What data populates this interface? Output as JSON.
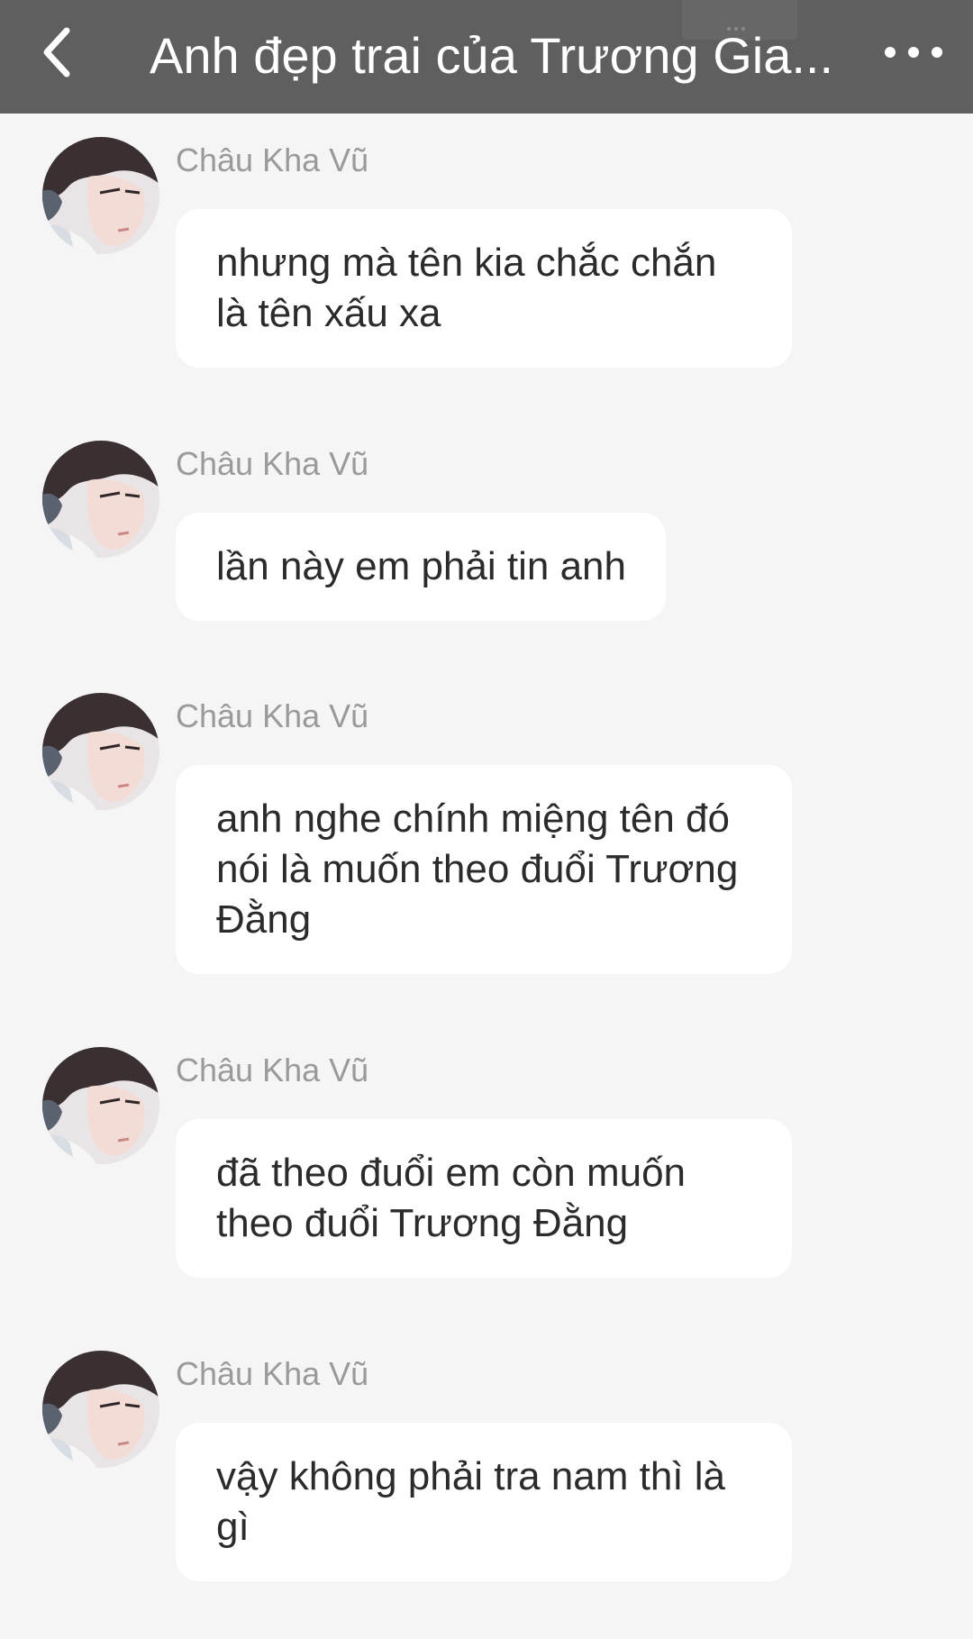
{
  "header": {
    "title": "Anh đẹp trai của Trương Gia...",
    "back_icon": "chevron-left-icon",
    "more_icon": "more-horizontal-icon",
    "background_color": "#5f5f5f"
  },
  "messages": [
    {
      "sender": "Châu Kha Vũ",
      "text": "nhưng mà tên kia chắc chắn là tên xấu xa"
    },
    {
      "sender": "Châu Kha Vũ",
      "text": "lần này em phải tin anh"
    },
    {
      "sender": "Châu Kha Vũ",
      "text": "anh nghe chính miệng tên đó nói là muốn theo đuổi Trương Đằng"
    },
    {
      "sender": "Châu Kha Vũ",
      "text": "đã theo đuổi em còn muốn theo đuổi Trương Đằng"
    },
    {
      "sender": "Châu Kha Vũ",
      "text": "vậy không phải tra nam thì là gì"
    }
  ]
}
